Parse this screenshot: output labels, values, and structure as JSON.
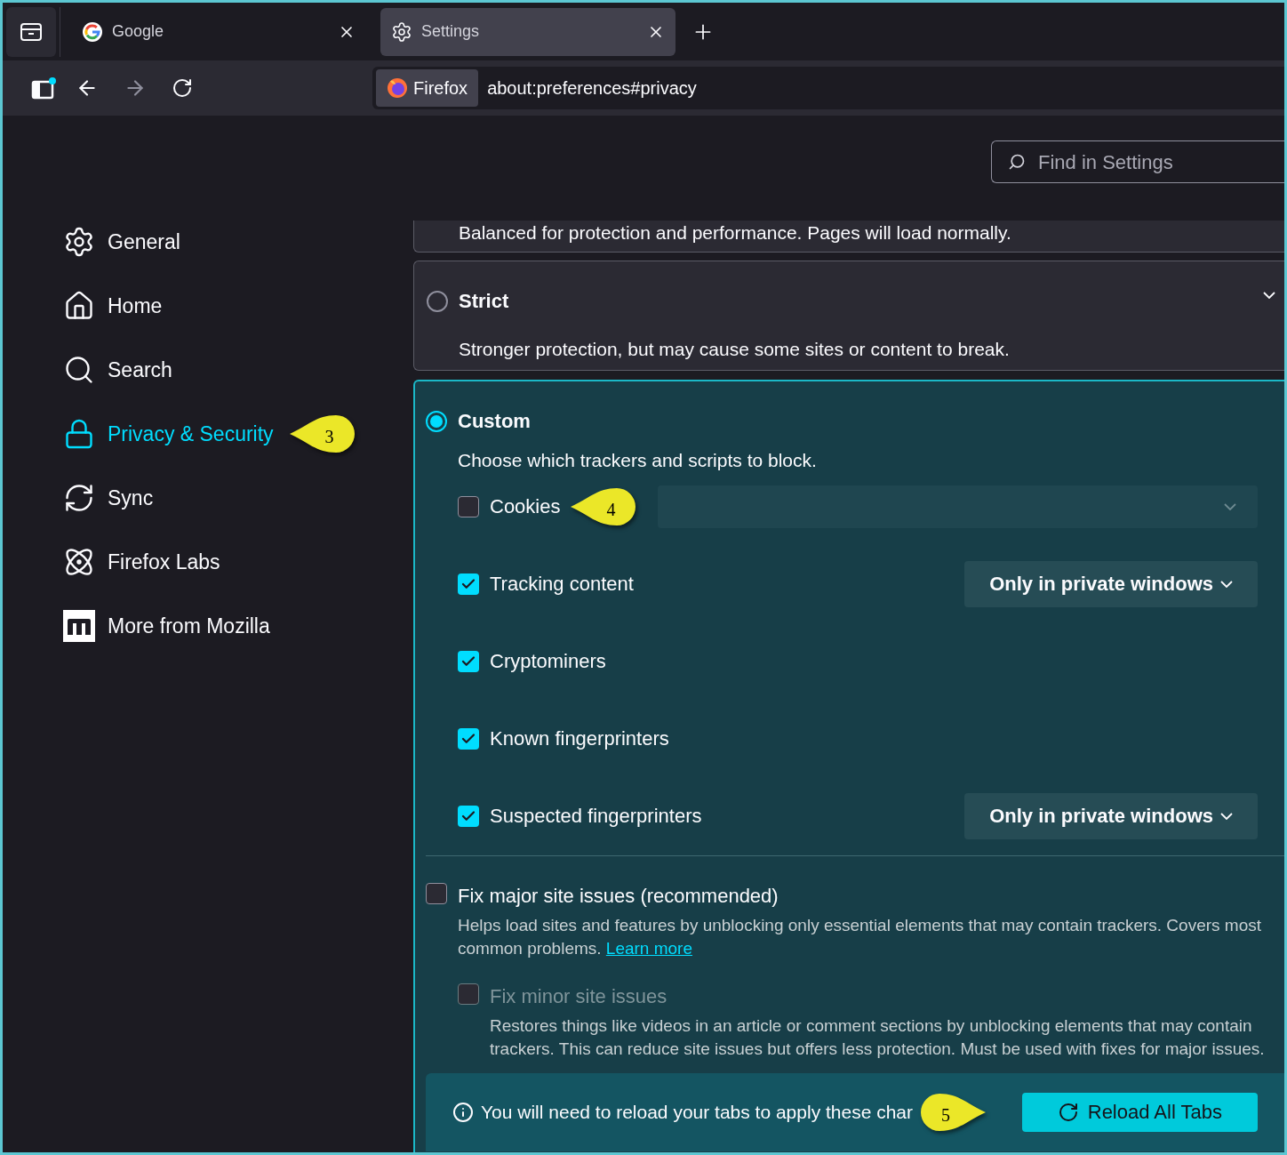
{
  "tabs": [
    {
      "title": "Google",
      "kind": "google",
      "selected": false
    },
    {
      "title": "Settings",
      "kind": "settings",
      "selected": true
    }
  ],
  "toolbar": {
    "identity": "Firefox",
    "url": "about:preferences#privacy"
  },
  "search": {
    "placeholder": "Find in Settings"
  },
  "sidebar": {
    "items": [
      {
        "label": "General",
        "kind": "general",
        "selected": false
      },
      {
        "label": "Home",
        "kind": "home",
        "selected": false
      },
      {
        "label": "Search",
        "kind": "search",
        "selected": false
      },
      {
        "label": "Privacy & Security",
        "kind": "privacy",
        "selected": true,
        "callout": "3"
      },
      {
        "label": "Sync",
        "kind": "sync",
        "selected": false
      },
      {
        "label": "Firefox Labs",
        "kind": "labs",
        "selected": false
      },
      {
        "label": "More from Mozilla",
        "kind": "mozilla",
        "selected": false
      }
    ]
  },
  "protection": {
    "balanced_description": "Balanced for protection and performance. Pages will load normally.",
    "options": [
      {
        "label": "Strict",
        "description": "Stronger protection, but may cause some sites or content to break.",
        "selected": false
      },
      {
        "label": "Custom",
        "description": "Choose which trackers and scripts to block.",
        "selected": true
      }
    ]
  },
  "trackers": [
    {
      "label": "Cookies",
      "checked": false,
      "kind": "dropdown",
      "callout": "4"
    },
    {
      "label": "Tracking content",
      "checked": true,
      "kind": "dropdown",
      "value": "Only in private windows"
    },
    {
      "label": "Cryptominers",
      "checked": true,
      "kind": "plain"
    },
    {
      "label": "Known fingerprinters",
      "checked": true,
      "kind": "plain"
    },
    {
      "label": "Suspected fingerprinters",
      "checked": true,
      "kind": "dropdown",
      "value": "Only in private windows"
    }
  ],
  "fixes": [
    {
      "label": "Fix major site issues (recommended)",
      "description": "Helps load sites and features by unblocking only essential elements that may contain trackers. Covers most common problems.",
      "link": "Learn more",
      "checked": false,
      "disabled": false
    },
    {
      "label": "Fix minor site issues",
      "description": "Restores things like videos in an article or comment sections by unblocking elements that may contain trackers. This can reduce site issues but offers less protection. Must be used with fixes for major issues.",
      "checked": false,
      "disabled": true
    }
  ],
  "reload": {
    "message": "You will need to reload your tabs to apply these char",
    "callout": "5",
    "button": "Reload All Tabs"
  }
}
